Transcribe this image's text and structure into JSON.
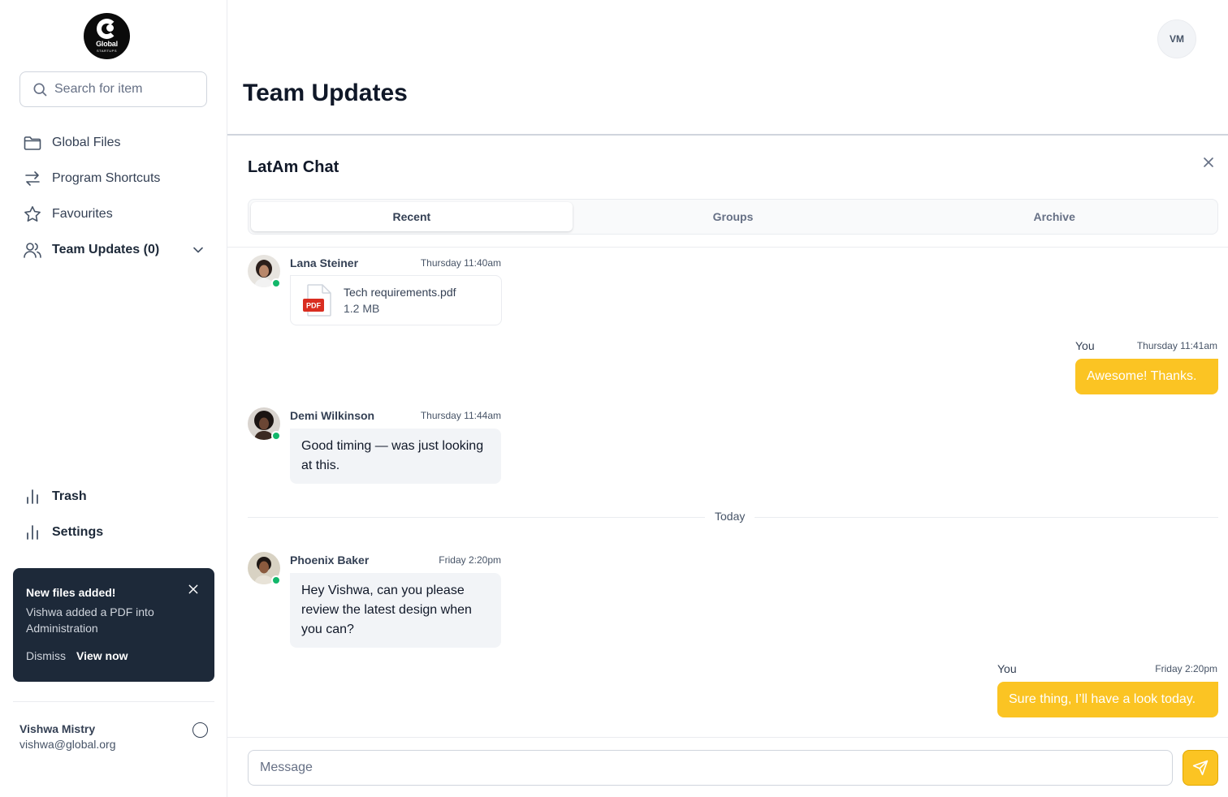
{
  "brand": {
    "logo_word": "Global",
    "logo_sub": "STARTUPS"
  },
  "sidebar": {
    "search_placeholder": "Search for item",
    "nav": [
      {
        "label": "Global Files",
        "icon": "folder-icon"
      },
      {
        "label": "Program Shortcuts",
        "icon": "shortcut-arrows-icon"
      },
      {
        "label": "Favourites",
        "icon": "star-icon"
      },
      {
        "label": "Team Updates (0)",
        "icon": "users-icon",
        "expanded": false
      }
    ],
    "footer_nav": [
      {
        "label": "Trash",
        "icon": "bar-chart-icon"
      },
      {
        "label": "Settings",
        "icon": "bar-chart-icon"
      }
    ],
    "toast": {
      "title": "New files added!",
      "body": "Vishwa added a PDF into Administration",
      "dismiss": "Dismiss",
      "view": "View now"
    },
    "account": {
      "name": "Vishwa Mistry",
      "email": "vishwa@global.org"
    }
  },
  "header": {
    "title": "Team Updates",
    "user_initials": "VM"
  },
  "chat": {
    "title": "LatAm Chat",
    "tabs": [
      {
        "label": "Recent",
        "active": true
      },
      {
        "label": "Groups",
        "active": false
      },
      {
        "label": "Archive",
        "active": false
      }
    ],
    "messages": [
      {
        "sender": "Lana Steiner",
        "time": "Thursday 11:40am",
        "type": "file",
        "file_name": "Tech requirements.pdf",
        "file_size": "1.2 MB",
        "file_badge": "PDF"
      },
      {
        "sender": "You",
        "time": "Thursday 11:41am",
        "text": "Awesome! Thanks."
      },
      {
        "sender": "Demi Wilkinson",
        "time": "Thursday 11:44am",
        "text": "Good timing — was just looking at this."
      },
      {
        "sender": "Phoenix Baker",
        "time": "Friday 2:20pm",
        "text": "Hey Vishwa, can you please review the latest design when you can?"
      },
      {
        "sender": "You",
        "time": "Friday 2:20pm",
        "text": "Sure thing, I’ll have a look today."
      }
    ],
    "day_divider": "Today",
    "composer_placeholder": "Message"
  },
  "colors": {
    "accent": "#fbc423",
    "toast_bg": "#1d2939",
    "online": "#12b76a"
  }
}
